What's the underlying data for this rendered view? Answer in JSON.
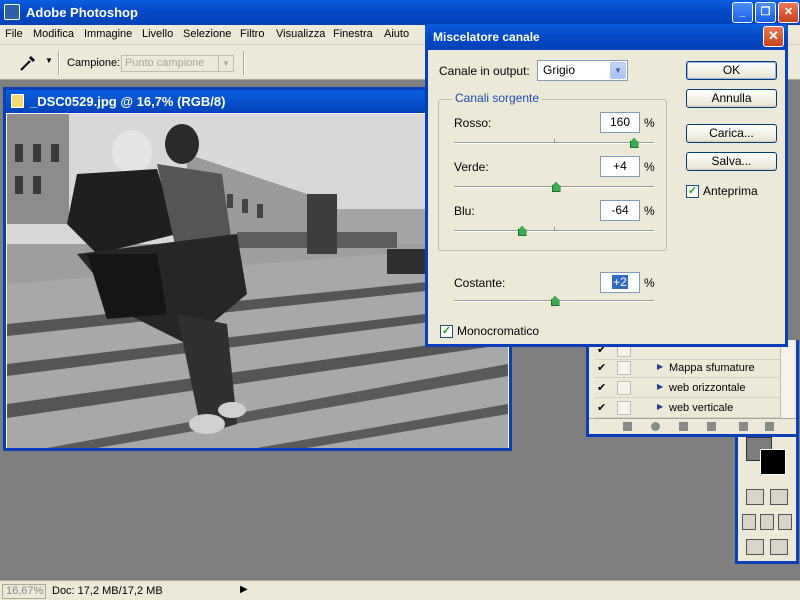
{
  "app": {
    "title": "Adobe Photoshop"
  },
  "menu": [
    "File",
    "Modifica",
    "Immagine",
    "Livello",
    "Selezione",
    "Filtro",
    "Visualizza",
    "Finestra",
    "Aiuto"
  ],
  "options": {
    "sample_label": "Campione:",
    "sample_value": "Punto campione"
  },
  "document": {
    "title": "_DSC0529.jpg @ 16,7% (RGB/8)"
  },
  "dialog": {
    "title": "Miscelatore canale",
    "output_label": "Canale in output:",
    "output_value": "Grigio",
    "group_label": "Canali sorgente",
    "channels": [
      {
        "label": "Rosso:",
        "value": "160",
        "fraction": 0.9
      },
      {
        "label": "Verde:",
        "value": "+4",
        "fraction": 0.51
      },
      {
        "label": "Blu:",
        "value": "-64",
        "fraction": 0.34
      }
    ],
    "constant": {
      "label": "Costante:",
      "value": "+2",
      "fraction": 0.505
    },
    "percent": "%",
    "monochrome_label": "Monocromatico",
    "monochrome_checked": true,
    "buttons": {
      "ok": "OK",
      "cancel": "Annulla",
      "load": "Carica...",
      "save": "Salva..."
    },
    "preview_label": "Anteprima",
    "preview_checked": true
  },
  "layers": [
    {
      "name": "Mappa sfumature"
    },
    {
      "name": "web orizzontale"
    },
    {
      "name": "web verticale"
    }
  ],
  "status": {
    "zoom": "16,67%",
    "doc": "Doc: 17,2 MB/17,2 MB"
  },
  "colors": {
    "titlebar": "#0448c4",
    "chrome": "#ece9d8",
    "workspace": "#7f7f7f",
    "slider_thumb": "#3caa50"
  }
}
